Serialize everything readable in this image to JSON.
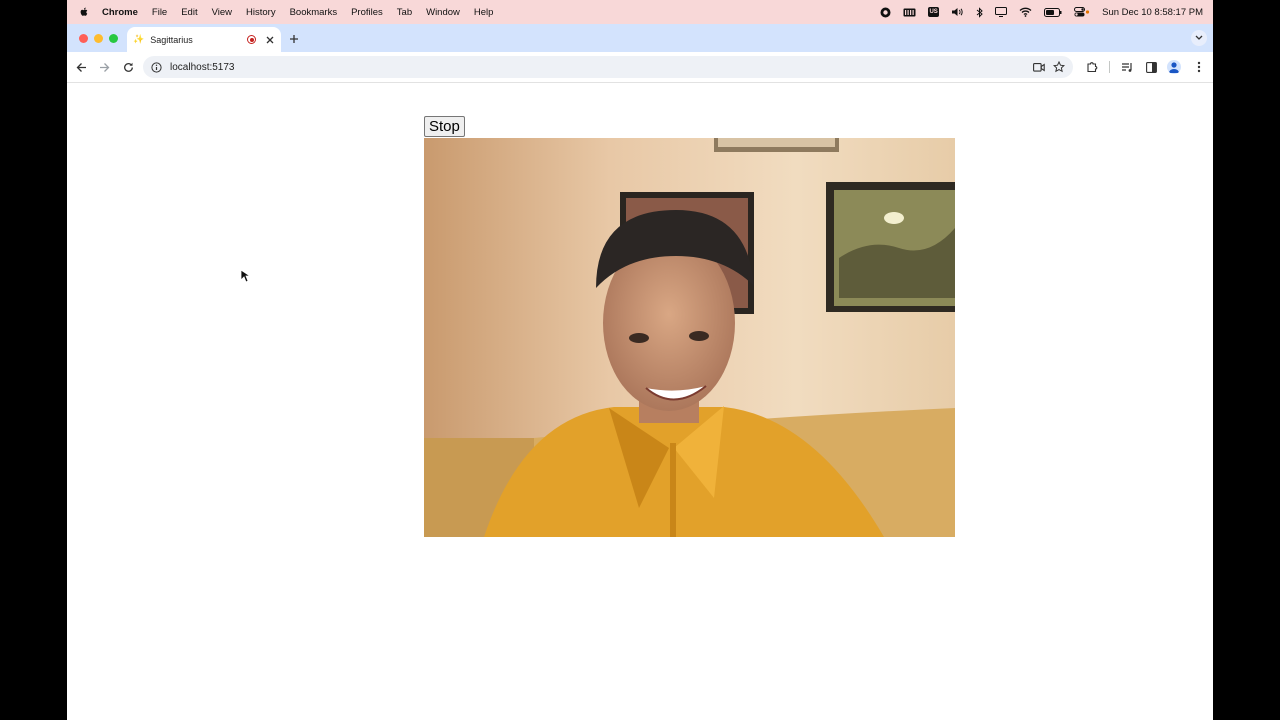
{
  "menubar": {
    "app": "Chrome",
    "items": [
      "File",
      "Edit",
      "View",
      "History",
      "Bookmarks",
      "Profiles",
      "Tab",
      "Window",
      "Help"
    ],
    "clock": "Sun Dec 10  8:58:17 PM",
    "input_source": "US"
  },
  "tab": {
    "title": "Sagittarius",
    "favicon": "sparkle-icon"
  },
  "omnibox": {
    "url": "localhost:5173"
  },
  "page": {
    "stop_label": "Stop",
    "video": "webcam-video-feed"
  },
  "colors": {
    "menubar_bg": "#f8d8d8",
    "tabstrip_bg": "#d3e3fd",
    "omnibox_bg": "#eef1f6",
    "recording_red": "#c5221f"
  }
}
